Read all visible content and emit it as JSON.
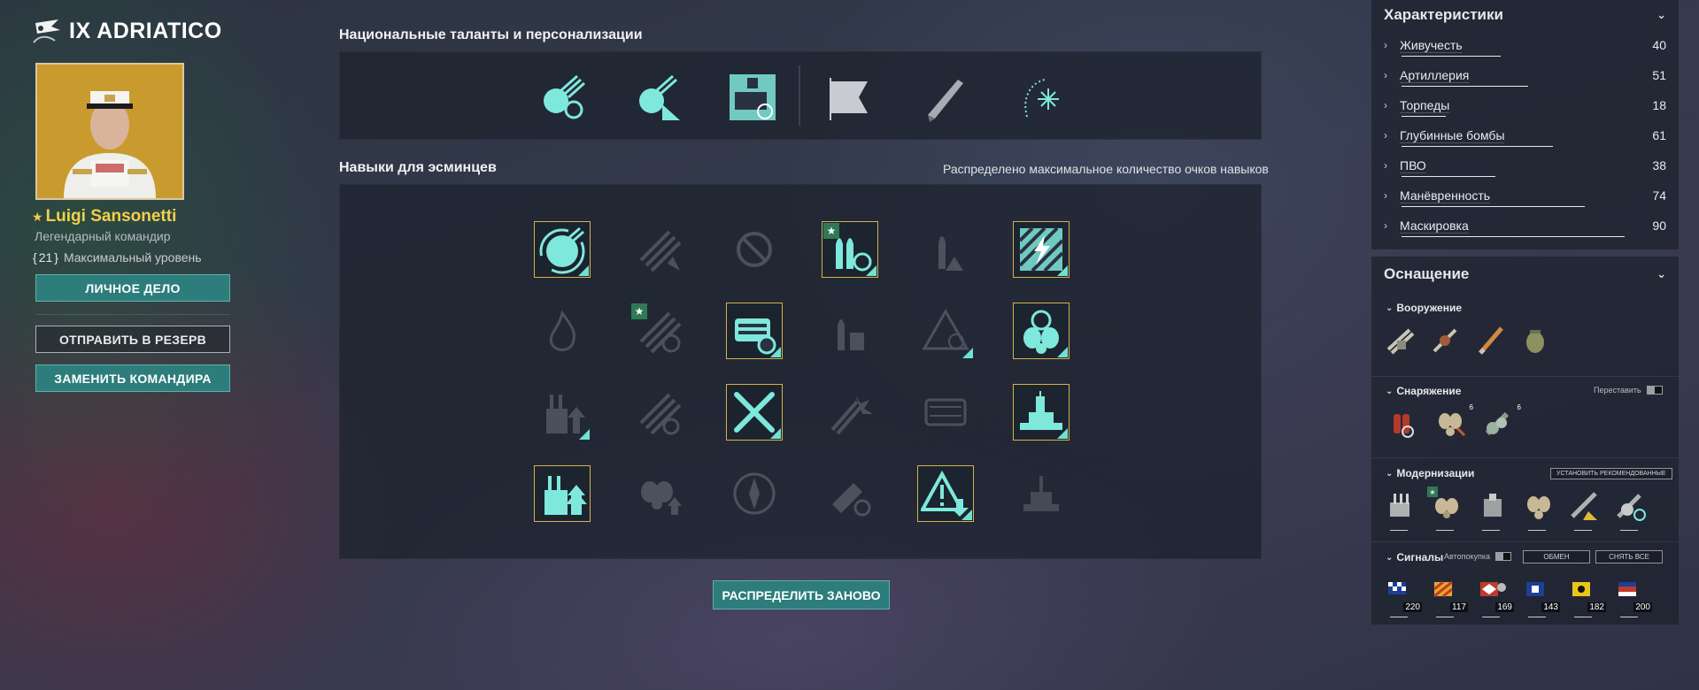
{
  "header": {
    "ship_title": "IX ADRIATICO"
  },
  "commander": {
    "name": "Luigi Sansonetti",
    "rank": "Легендарный командир",
    "level": "21",
    "level_label": "Максимальный уровень",
    "btn_personal": "ЛИЧНОЕ ДЕЛО",
    "btn_reserve": "ОТПРАВИТЬ В РЕЗЕРВ",
    "btn_replace": "ЗАМЕНИТЬ КОМАНДИРА"
  },
  "talents": {
    "title": "Национальные таланты и персонализации",
    "items": [
      {
        "icon": "fast-loader-talent-icon",
        "active": true
      },
      {
        "icon": "smoke-guns-talent-icon",
        "active": true
      },
      {
        "icon": "torpedo-tubes-talent-icon",
        "active": true
      },
      {
        "icon": "flag-icon",
        "active": false
      },
      {
        "icon": "knife-icon",
        "active": false
      },
      {
        "icon": "sparkle-icon",
        "active": true
      }
    ]
  },
  "skills": {
    "title": "Навыки для эсминцев",
    "status": "Распределено максимальное количество очков навыков",
    "rows": [
      [
        {
          "icon": "reload-gun-skill-icon",
          "selected": true,
          "star": false
        },
        {
          "icon": "torpedo-range-skill-icon",
          "selected": false,
          "star": false
        },
        {
          "icon": "prohibit-skill-icon",
          "selected": false,
          "star": false
        },
        {
          "icon": "shell-reload-skill-icon",
          "selected": true,
          "star": true
        },
        {
          "icon": "shell-alert-skill-icon",
          "selected": false,
          "star": false
        },
        {
          "icon": "lightning-skill-icon",
          "selected": true,
          "star": false
        }
      ],
      [
        {
          "icon": "fire-skill-icon",
          "selected": false,
          "star": false
        },
        {
          "icon": "torpedo-speed-skill-icon",
          "selected": false,
          "star": true
        },
        {
          "icon": "torpedo-tube-skill-icon",
          "selected": true,
          "star": false
        },
        {
          "icon": "shell-stack-skill-icon",
          "selected": false,
          "star": false
        },
        {
          "icon": "alert-target-skill-icon",
          "selected": false,
          "star": false
        },
        {
          "icon": "propeller-wheel-skill-icon",
          "selected": true,
          "star": false
        }
      ],
      [
        {
          "icon": "turret-up-skill-icon",
          "selected": false,
          "star": false
        },
        {
          "icon": "torpedo-reload-skill-icon",
          "selected": false,
          "star": false
        },
        {
          "icon": "crossed-torpedoes-skill-icon",
          "selected": true,
          "star": false
        },
        {
          "icon": "aa-burst-skill-icon",
          "selected": false,
          "star": false
        },
        {
          "icon": "tubes-skill-icon",
          "selected": false,
          "star": false
        },
        {
          "icon": "battleship-skill-icon",
          "selected": true,
          "star": false
        }
      ],
      [
        {
          "icon": "turret-boost-skill-icon",
          "selected": true,
          "star": false
        },
        {
          "icon": "propeller-up-skill-icon",
          "selected": false,
          "star": false
        },
        {
          "icon": "compass-skill-icon",
          "selected": false,
          "star": false
        },
        {
          "icon": "shell-timer-skill-icon",
          "selected": false,
          "star": false
        },
        {
          "icon": "warning-down-skill-icon",
          "selected": true,
          "star": false
        },
        {
          "icon": "ship-silhouette-skill-icon",
          "selected": false,
          "star": false
        }
      ]
    ],
    "btn_redistribute": "РАСПРЕДЕЛИТЬ ЗАНОВО"
  },
  "characteristics": {
    "title": "Характеристики",
    "stats": [
      {
        "name": "Живучесть",
        "value": 40
      },
      {
        "name": "Артиллерия",
        "value": 51
      },
      {
        "name": "Торпеды",
        "value": 18
      },
      {
        "name": "Глубинные бомбы",
        "value": 61
      },
      {
        "name": "ПВО",
        "value": 38
      },
      {
        "name": "Манёвренность",
        "value": 74
      },
      {
        "name": "Маскировка",
        "value": 90
      }
    ]
  },
  "equipment": {
    "title": "Оснащение",
    "armament": {
      "label": "Вооружение"
    },
    "consumables": {
      "label": "Снаряжение",
      "swap_label": "Переставить",
      "counts": [
        "6",
        "6"
      ]
    },
    "upgrades": {
      "label": "Модернизации",
      "install_btn": "УСТАНОВИТЬ РЕКОМЕНДОВАННЫЕ"
    },
    "signals": {
      "label": "Сигналы",
      "autobuy_label": "Автопокупка",
      "exchange_btn": "ОБМЕН",
      "remove_btn": "СНЯТЬ ВСЕ",
      "counts": [
        "220",
        "117",
        "169",
        "143",
        "182",
        "200"
      ]
    }
  },
  "colors": {
    "accent": "#2c7d7b",
    "skill_active": "#6fe0d4",
    "gold": "#f2d04a",
    "selected_border": "#d6b14f"
  }
}
